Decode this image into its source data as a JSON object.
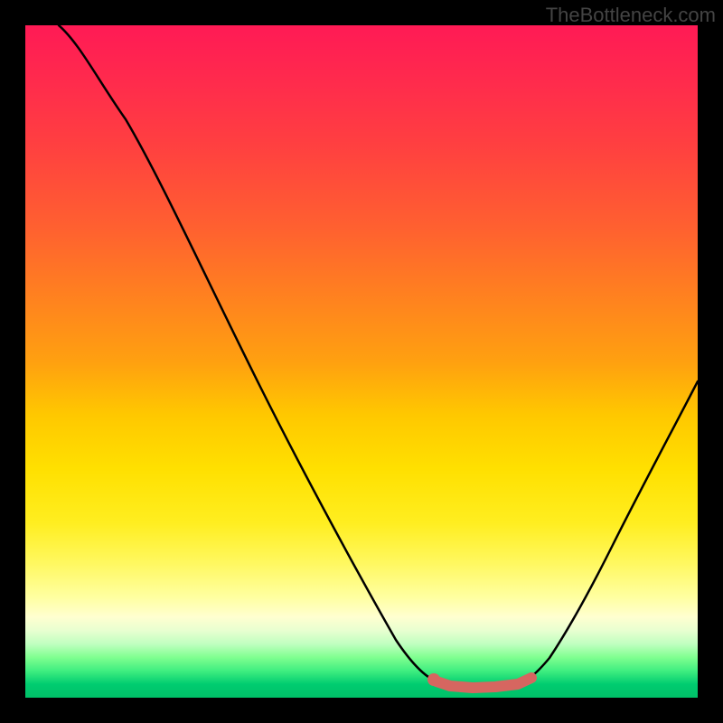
{
  "watermark": "TheBottleneck.com",
  "chart_data": {
    "type": "line",
    "title": "",
    "xlabel": "",
    "ylabel": "",
    "xlim": [
      0,
      100
    ],
    "ylim": [
      0,
      100
    ],
    "background_gradient": {
      "top_color": "#ff1a55",
      "mid_color": "#ffe000",
      "bottom_color": "#00c068",
      "description": "vertical gradient red (high bottleneck) to yellow to green (low bottleneck)"
    },
    "curve": {
      "description": "V-shaped bottleneck curve: steep descent from top-left, minimum plateau around x=60-73, rises to mid-right edge",
      "points": [
        {
          "x": 5,
          "y": 100
        },
        {
          "x": 10,
          "y": 98
        },
        {
          "x": 15,
          "y": 93
        },
        {
          "x": 20,
          "y": 86
        },
        {
          "x": 25,
          "y": 77
        },
        {
          "x": 30,
          "y": 67
        },
        {
          "x": 35,
          "y": 56
        },
        {
          "x": 40,
          "y": 44
        },
        {
          "x": 45,
          "y": 33
        },
        {
          "x": 50,
          "y": 21
        },
        {
          "x": 55,
          "y": 11
        },
        {
          "x": 58,
          "y": 5
        },
        {
          "x": 60,
          "y": 2.5
        },
        {
          "x": 63,
          "y": 1.5
        },
        {
          "x": 66,
          "y": 1.2
        },
        {
          "x": 70,
          "y": 1.3
        },
        {
          "x": 73,
          "y": 2
        },
        {
          "x": 76,
          "y": 4
        },
        {
          "x": 80,
          "y": 9
        },
        {
          "x": 85,
          "y": 18
        },
        {
          "x": 90,
          "y": 28
        },
        {
          "x": 95,
          "y": 38
        },
        {
          "x": 100,
          "y": 47
        }
      ]
    },
    "highlight": {
      "description": "salmon-colored thick segment marking the optimal low-bottleneck region",
      "color": "#d66660",
      "points": [
        {
          "x": 60,
          "y": 2.5
        },
        {
          "x": 63,
          "y": 1.5
        },
        {
          "x": 66,
          "y": 1.2
        },
        {
          "x": 70,
          "y": 1.3
        },
        {
          "x": 73,
          "y": 2
        },
        {
          "x": 75,
          "y": 3.5
        }
      ],
      "start_dot": {
        "x": 60,
        "y": 2.5
      }
    }
  }
}
